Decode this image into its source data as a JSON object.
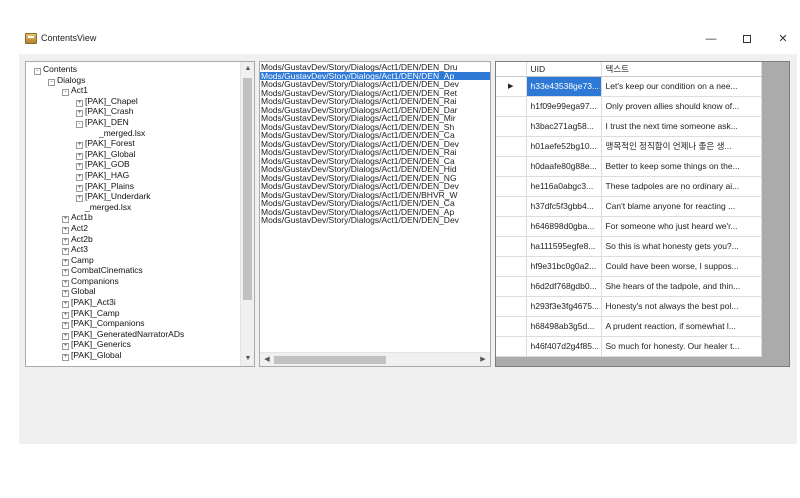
{
  "window": {
    "title": "ContentsView",
    "minimize_glyph": "—",
    "close_glyph": "✕"
  },
  "tree": {
    "items": [
      {
        "label": "Contents",
        "depth": 0,
        "expander": "-"
      },
      {
        "label": "Dialogs",
        "depth": 1,
        "expander": "-"
      },
      {
        "label": "Act1",
        "depth": 2,
        "expander": "-"
      },
      {
        "label": "[PAK]_Chapel",
        "depth": 3,
        "expander": "+"
      },
      {
        "label": "[PAK]_Crash",
        "depth": 3,
        "expander": "+"
      },
      {
        "label": "[PAK]_DEN",
        "depth": 3,
        "expander": "-"
      },
      {
        "label": "_merged.lsx",
        "depth": 4,
        "expander": ""
      },
      {
        "label": "[PAK]_Forest",
        "depth": 3,
        "expander": "+"
      },
      {
        "label": "[PAK]_Global",
        "depth": 3,
        "expander": "+"
      },
      {
        "label": "[PAK]_GOB",
        "depth": 3,
        "expander": "+"
      },
      {
        "label": "[PAK]_HAG",
        "depth": 3,
        "expander": "+"
      },
      {
        "label": "[PAK]_Plains",
        "depth": 3,
        "expander": "+"
      },
      {
        "label": "[PAK]_Underdark",
        "depth": 3,
        "expander": "+"
      },
      {
        "label": "_merged.lsx",
        "depth": 3,
        "expander": ""
      },
      {
        "label": "Act1b",
        "depth": 2,
        "expander": "+"
      },
      {
        "label": "Act2",
        "depth": 2,
        "expander": "+"
      },
      {
        "label": "Act2b",
        "depth": 2,
        "expander": "+"
      },
      {
        "label": "Act3",
        "depth": 2,
        "expander": "+"
      },
      {
        "label": "Camp",
        "depth": 2,
        "expander": "+"
      },
      {
        "label": "CombatCinematics",
        "depth": 2,
        "expander": "+"
      },
      {
        "label": "Companions",
        "depth": 2,
        "expander": "+"
      },
      {
        "label": "Global",
        "depth": 2,
        "expander": "+"
      },
      {
        "label": "[PAK]_Act3i",
        "depth": 2,
        "expander": "+"
      },
      {
        "label": "[PAK]_Camp",
        "depth": 2,
        "expander": "+"
      },
      {
        "label": "[PAK]_Companions",
        "depth": 2,
        "expander": "+"
      },
      {
        "label": "[PAK]_GeneratedNarratorADs",
        "depth": 2,
        "expander": "+"
      },
      {
        "label": "[PAK]_Generics",
        "depth": 2,
        "expander": "+"
      },
      {
        "label": "[PAK]_Global",
        "depth": 2,
        "expander": "+"
      }
    ]
  },
  "file_list": {
    "selected_index": 1,
    "items": [
      "Mods/GustavDev/Story/Dialogs/Act1/DEN/DEN_Dru",
      "Mods/GustavDev/Story/Dialogs/Act1/DEN/DEN_Ap",
      "Mods/GustavDev/Story/Dialogs/Act1/DEN/DEN_Dev",
      "Mods/GustavDev/Story/Dialogs/Act1/DEN/DEN_Ret",
      "Mods/GustavDev/Story/Dialogs/Act1/DEN/DEN_Rai",
      "Mods/GustavDev/Story/Dialogs/Act1/DEN/DEN_Dar",
      "Mods/GustavDev/Story/Dialogs/Act1/DEN/DEN_Mir",
      "Mods/GustavDev/Story/Dialogs/Act1/DEN/DEN_Sh",
      "Mods/GustavDev/Story/Dialogs/Act1/DEN/DEN_Ca",
      "Mods/GustavDev/Story/Dialogs/Act1/DEN/DEN_Dev",
      "Mods/GustavDev/Story/Dialogs/Act1/DEN/DEN_Rai",
      "Mods/GustavDev/Story/Dialogs/Act1/DEN/DEN_Ca",
      "Mods/GustavDev/Story/Dialogs/Act1/DEN/DEN_Hid",
      "Mods/GustavDev/Story/Dialogs/Act1/DEN/DEN_NG",
      "Mods/GustavDev/Story/Dialogs/Act1/DEN/DEN_Dev",
      "Mods/GustavDev/Story/Dialogs/Act1/DEN/BHVR_W",
      "Mods/GustavDev/Story/Dialogs/Act1/DEN/DEN_Ca",
      "Mods/GustavDev/Story/Dialogs/Act1/DEN/DEN_Ap",
      "Mods/GustavDev/Story/Dialogs/Act1/DEN/DEN_Dev"
    ]
  },
  "grid": {
    "columns": [
      "UID",
      "텍스트"
    ],
    "current_row_marker": "▶",
    "rows": [
      {
        "uid": "h33e43538ge73...",
        "text": "Let's keep our condition on a nee..."
      },
      {
        "uid": "h1f09e99ega97...",
        "text": "Only proven allies should know of..."
      },
      {
        "uid": "h3bac271ag58...",
        "text": "I trust the next time someone ask..."
      },
      {
        "uid": "h01aefe52bg10...",
        "text": "맹목적인 정직함이 언제나 좋은 생..."
      },
      {
        "uid": "h0daafe80g88e...",
        "text": "Better to keep some things on the..."
      },
      {
        "uid": "he116a0abgc3...",
        "text": "These tadpoles are no ordinary ai..."
      },
      {
        "uid": "h37dfc5f3gbb4...",
        "text": "Can't blame anyone for reacting ..."
      },
      {
        "uid": "h646898d0gba...",
        "text": "For someone who just heard we'r..."
      },
      {
        "uid": "ha111595egfe8...",
        "text": "So this is what honesty gets you?..."
      },
      {
        "uid": "hf9e31bc0g0a2...",
        "text": "Could have been worse, I suppos..."
      },
      {
        "uid": "h6d2df768gdb0...",
        "text": "She hears of the tadpole, and thin..."
      },
      {
        "uid": "h293f3e3fg4675...",
        "text": "Honesty's not always the best pol..."
      },
      {
        "uid": "h68498ab3g5d...",
        "text": "A prudent reaction, if somewhat l..."
      },
      {
        "uid": "h46f407d2g4f85...",
        "text": "So much for honesty. Our healer t..."
      }
    ]
  },
  "icons": {
    "app": "app-icon",
    "scroll_up": "▲",
    "scroll_down": "▼",
    "scroll_left": "◀",
    "scroll_right": "▶"
  }
}
